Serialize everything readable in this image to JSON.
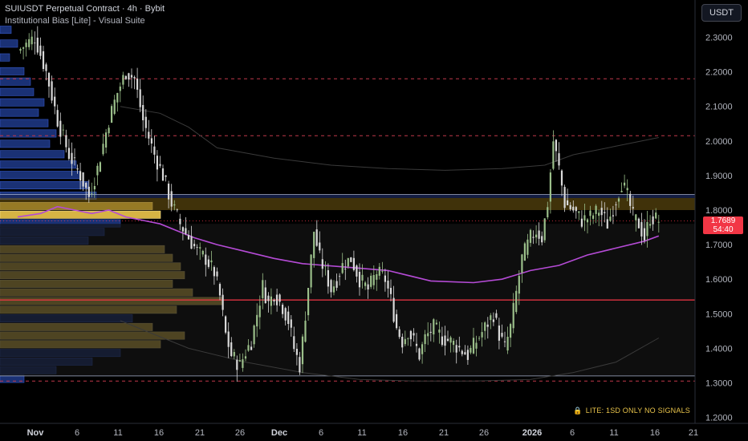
{
  "header": {
    "symbol_line": "SUIUSDT Perpetual Contract · 4h · Bybit",
    "indicator_line": "Institutional Bias [Lite] - Visual Suite"
  },
  "currency_button": "USDT",
  "price_tag": {
    "price": "1.7689",
    "countdown": "54:40"
  },
  "lite_note": {
    "icon": "lock-icon",
    "text": "LITE: 1SD ONLY NO SIGNALS"
  },
  "colors": {
    "background": "#000000",
    "up_candle": "#9bbf8a",
    "down_candle": "#d9d9d9",
    "vwap": "#b54bd6",
    "profile_blue": "#1f3a8a",
    "profile_yellow": "#e8c34a",
    "poc_line": "#f23645",
    "price_tag": "#f23645"
  },
  "chart_data": {
    "type": "candlestick",
    "title": "SUIUSDT Perpetual Contract · 4h · Bybit",
    "y_ticks": [
      "2.3000",
      "2.2000",
      "2.1000",
      "2.0000",
      "1.9000",
      "1.8000",
      "1.7000",
      "1.6000",
      "1.5000",
      "1.4000",
      "1.3000",
      "1.2000"
    ],
    "ylim": [
      1.18,
      2.42
    ],
    "x_ticks": [
      "Nov",
      "6",
      "11",
      "16",
      "21",
      "26",
      "Dec",
      "6",
      "11",
      "16",
      "21",
      "26",
      "2026",
      "6",
      "11",
      "16",
      "21"
    ],
    "bold_x_ticks": [
      "Nov",
      "Dec",
      "2026"
    ],
    "last_price": 1.7689,
    "poc_price": 1.54,
    "value_area": [
      1.8,
      1.835
    ],
    "dashed_levels": [
      2.18,
      2.015,
      1.305
    ],
    "range_lines": [
      1.32,
      1.845
    ],
    "close_path": [
      [
        0,
        2.26
      ],
      [
        6,
        2.3
      ],
      [
        10,
        2.2
      ],
      [
        14,
        2.06
      ],
      [
        18,
        1.96
      ],
      [
        22,
        1.9
      ],
      [
        25,
        1.84
      ],
      [
        28,
        1.92
      ],
      [
        32,
        2.06
      ],
      [
        35,
        2.14
      ],
      [
        38,
        2.2
      ],
      [
        41,
        2.18
      ],
      [
        44,
        2.06
      ],
      [
        48,
        1.96
      ],
      [
        51,
        1.9
      ],
      [
        54,
        1.82
      ],
      [
        57,
        1.76
      ],
      [
        60,
        1.72
      ],
      [
        63,
        1.68
      ],
      [
        66,
        1.66
      ],
      [
        69,
        1.62
      ],
      [
        71,
        1.55
      ],
      [
        73,
        1.44
      ],
      [
        75,
        1.38
      ],
      [
        78,
        1.35
      ],
      [
        80,
        1.39
      ],
      [
        82,
        1.42
      ],
      [
        84,
        1.5
      ],
      [
        86,
        1.58
      ],
      [
        88,
        1.53
      ],
      [
        90,
        1.56
      ],
      [
        93,
        1.52
      ],
      [
        95,
        1.48
      ],
      [
        97,
        1.4
      ],
      [
        99,
        1.35
      ],
      [
        100,
        1.42
      ],
      [
        102,
        1.58
      ],
      [
        104,
        1.74
      ],
      [
        106,
        1.66
      ],
      [
        108,
        1.62
      ],
      [
        110,
        1.57
      ],
      [
        112,
        1.6
      ],
      [
        114,
        1.64
      ],
      [
        117,
        1.66
      ],
      [
        120,
        1.6
      ],
      [
        123,
        1.57
      ],
      [
        126,
        1.62
      ],
      [
        129,
        1.6
      ],
      [
        131,
        1.54
      ],
      [
        133,
        1.46
      ],
      [
        135,
        1.42
      ],
      [
        137,
        1.45
      ],
      [
        139,
        1.42
      ],
      [
        141,
        1.38
      ],
      [
        143,
        1.43
      ],
      [
        146,
        1.46
      ],
      [
        149,
        1.43
      ],
      [
        152,
        1.42
      ],
      [
        155,
        1.4
      ],
      [
        158,
        1.38
      ],
      [
        161,
        1.42
      ],
      [
        164,
        1.46
      ],
      [
        167,
        1.5
      ],
      [
        169,
        1.44
      ],
      [
        171,
        1.4
      ],
      [
        173,
        1.46
      ],
      [
        175,
        1.56
      ],
      [
        177,
        1.66
      ],
      [
        180,
        1.72
      ],
      [
        182,
        1.74
      ],
      [
        184,
        1.72
      ],
      [
        186,
        1.82
      ],
      [
        188,
        2.0
      ],
      [
        190,
        1.92
      ],
      [
        192,
        1.82
      ],
      [
        195,
        1.8
      ],
      [
        198,
        1.77
      ],
      [
        201,
        1.78
      ],
      [
        204,
        1.8
      ],
      [
        207,
        1.76
      ],
      [
        210,
        1.83
      ],
      [
        212,
        1.88
      ],
      [
        214,
        1.84
      ],
      [
        216,
        1.78
      ],
      [
        218,
        1.76
      ],
      [
        220,
        1.72
      ],
      [
        222,
        1.78
      ],
      [
        225,
        1.77
      ]
    ],
    "vwap_path": [
      [
        0,
        1.78
      ],
      [
        8,
        1.79
      ],
      [
        14,
        1.81
      ],
      [
        20,
        1.8
      ],
      [
        26,
        1.79
      ],
      [
        32,
        1.8
      ],
      [
        38,
        1.78
      ],
      [
        44,
        1.77
      ],
      [
        50,
        1.76
      ],
      [
        56,
        1.74
      ],
      [
        62,
        1.72
      ],
      [
        70,
        1.7
      ],
      [
        80,
        1.68
      ],
      [
        90,
        1.66
      ],
      [
        100,
        1.645
      ],
      [
        115,
        1.635
      ],
      [
        130,
        1.625
      ],
      [
        145,
        1.595
      ],
      [
        160,
        1.59
      ],
      [
        170,
        1.6
      ],
      [
        180,
        1.625
      ],
      [
        190,
        1.64
      ],
      [
        200,
        1.67
      ],
      [
        210,
        1.69
      ],
      [
        220,
        1.71
      ],
      [
        225,
        1.725
      ]
    ],
    "upper_band_path": [
      [
        36,
        2.1
      ],
      [
        50,
        2.08
      ],
      [
        60,
        2.04
      ],
      [
        70,
        1.98
      ],
      [
        90,
        1.95
      ],
      [
        110,
        1.93
      ],
      [
        130,
        1.92
      ],
      [
        150,
        1.915
      ],
      [
        170,
        1.92
      ],
      [
        185,
        1.93
      ],
      [
        195,
        1.96
      ],
      [
        210,
        1.985
      ],
      [
        225,
        2.01
      ]
    ],
    "lower_band_path": [
      [
        36,
        1.48
      ],
      [
        60,
        1.4
      ],
      [
        80,
        1.36
      ],
      [
        100,
        1.33
      ],
      [
        120,
        1.31
      ],
      [
        140,
        1.305
      ],
      [
        160,
        1.305
      ],
      [
        180,
        1.31
      ],
      [
        195,
        1.33
      ],
      [
        210,
        1.36
      ],
      [
        225,
        1.43
      ]
    ],
    "volume_profile": {
      "price_range": [
        1.3,
        2.33
      ],
      "buckets": [
        {
          "p": 2.32,
          "v": 14,
          "c": "blue"
        },
        {
          "p": 2.28,
          "v": 22,
          "c": "blue"
        },
        {
          "p": 2.24,
          "v": 12,
          "c": "blue"
        },
        {
          "p": 2.2,
          "v": 30,
          "c": "blue"
        },
        {
          "p": 2.17,
          "v": 38,
          "c": "blue"
        },
        {
          "p": 2.14,
          "v": 42,
          "c": "blue"
        },
        {
          "p": 2.11,
          "v": 55,
          "c": "blue"
        },
        {
          "p": 2.08,
          "v": 48,
          "c": "blue"
        },
        {
          "p": 2.05,
          "v": 60,
          "c": "blue"
        },
        {
          "p": 2.02,
          "v": 70,
          "c": "blue"
        },
        {
          "p": 1.99,
          "v": 62,
          "c": "blue"
        },
        {
          "p": 1.96,
          "v": 80,
          "c": "blue"
        },
        {
          "p": 1.93,
          "v": 95,
          "c": "blue"
        },
        {
          "p": 1.9,
          "v": 100,
          "c": "blue"
        },
        {
          "p": 1.87,
          "v": 110,
          "c": "blue"
        },
        {
          "p": 1.84,
          "v": 120,
          "c": "blue"
        },
        {
          "p": 1.81,
          "v": 190,
          "c": "yellow"
        },
        {
          "p": 1.785,
          "v": 200,
          "c": "yellow"
        },
        {
          "p": 1.76,
          "v": 150,
          "c": "blue"
        },
        {
          "p": 1.735,
          "v": 130,
          "c": "blue"
        },
        {
          "p": 1.71,
          "v": 110,
          "c": "blue"
        },
        {
          "p": 1.685,
          "v": 205,
          "c": "yellow"
        },
        {
          "p": 1.66,
          "v": 215,
          "c": "yellow"
        },
        {
          "p": 1.635,
          "v": 225,
          "c": "yellow"
        },
        {
          "p": 1.61,
          "v": 230,
          "c": "yellow"
        },
        {
          "p": 1.585,
          "v": 215,
          "c": "yellow"
        },
        {
          "p": 1.56,
          "v": 240,
          "c": "yellow"
        },
        {
          "p": 1.535,
          "v": 278,
          "c": "yellow"
        },
        {
          "p": 1.51,
          "v": 220,
          "c": "yellow"
        },
        {
          "p": 1.485,
          "v": 165,
          "c": "blue"
        },
        {
          "p": 1.46,
          "v": 190,
          "c": "yellow"
        },
        {
          "p": 1.435,
          "v": 230,
          "c": "yellow"
        },
        {
          "p": 1.41,
          "v": 200,
          "c": "yellow"
        },
        {
          "p": 1.385,
          "v": 150,
          "c": "blue"
        },
        {
          "p": 1.36,
          "v": 115,
          "c": "blue"
        },
        {
          "p": 1.335,
          "v": 70,
          "c": "blue"
        },
        {
          "p": 1.31,
          "v": 30,
          "c": "blue"
        }
      ]
    }
  }
}
